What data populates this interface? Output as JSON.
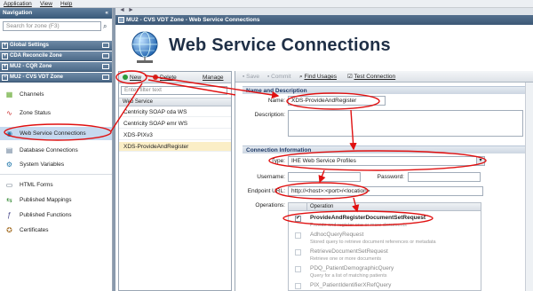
{
  "menubar": {
    "items": [
      "Application",
      "View",
      "Help"
    ]
  },
  "nav": {
    "title": "Navigation",
    "collapse_icon": "«",
    "search_placeholder": "Search for zone (F3)",
    "zones": [
      "Global Settings",
      "CDA Reconcile Zone",
      "MU2 - CQR Zone",
      "MU2 - CVS VDT Zone"
    ],
    "items": [
      "Channels",
      "Zone Status",
      "Web Service Connections",
      "Database Connections",
      "System Variables",
      "HTML Forms",
      "Published Mappings",
      "Published Functions",
      "Certificates"
    ],
    "active_item": "Web Service Connections"
  },
  "topbar": {
    "back": "◄",
    "forward": "►"
  },
  "tab": {
    "title": "MU2 - CVS VDT Zone - Web Service Connections"
  },
  "header": {
    "title": "Web Service Connections"
  },
  "list": {
    "toolbar": {
      "new": "New",
      "delete": "Delete",
      "manage": "Manage"
    },
    "filter_placeholder": "Enter filter text",
    "column": "Web Service",
    "rows": [
      "Centricity SOAP cda WS",
      "Centricity SOAP emr WS",
      "XDS-PIXv3",
      "XDS-ProvideAndRegister"
    ],
    "selected_row": "XDS-ProvideAndRegister"
  },
  "detail": {
    "toolbar": {
      "save": "Save",
      "commit": "Commit",
      "find_usages": "Find Usages",
      "test_connection": "Test Connection"
    },
    "name_section": "Name and Description",
    "name_label": "Name:",
    "name_value": "XDS-ProvideAndRegister",
    "description_label": "Description:",
    "conn_section": "Connection Information",
    "type_label": "Type:",
    "type_value": "IHE Web Service Profiles",
    "username_label": "Username:",
    "password_label": "Password:",
    "endpoint_label": "Endpoint URL:",
    "endpoint_value": "http://<host>:<port>/<location>",
    "operations_label": "Operations:",
    "operations_column": "Operation",
    "operations": [
      {
        "name": "ProvideAndRegisterDocumentSetRequest",
        "desc": "Provide and register one or more documents",
        "checked": true
      },
      {
        "name": "AdhocQueryRequest",
        "desc": "Stored query to retrieve document references or metadata",
        "checked": false
      },
      {
        "name": "RetrieveDocumentSetRequest",
        "desc": "Retrieve one or more documents",
        "checked": false
      },
      {
        "name": "PDQ_PatientDemographicQuery",
        "desc": "Query for a list of matching patients",
        "checked": false
      },
      {
        "name": "PIX_PatientIdentifierXRefQuery",
        "desc": "",
        "checked": false
      }
    ]
  },
  "colors": {
    "annotation": "#e01010",
    "nav_header": "#39597a",
    "active_item": "#c6d9ef",
    "selected_row": "#fbeec6",
    "title": "#1f2f46"
  }
}
